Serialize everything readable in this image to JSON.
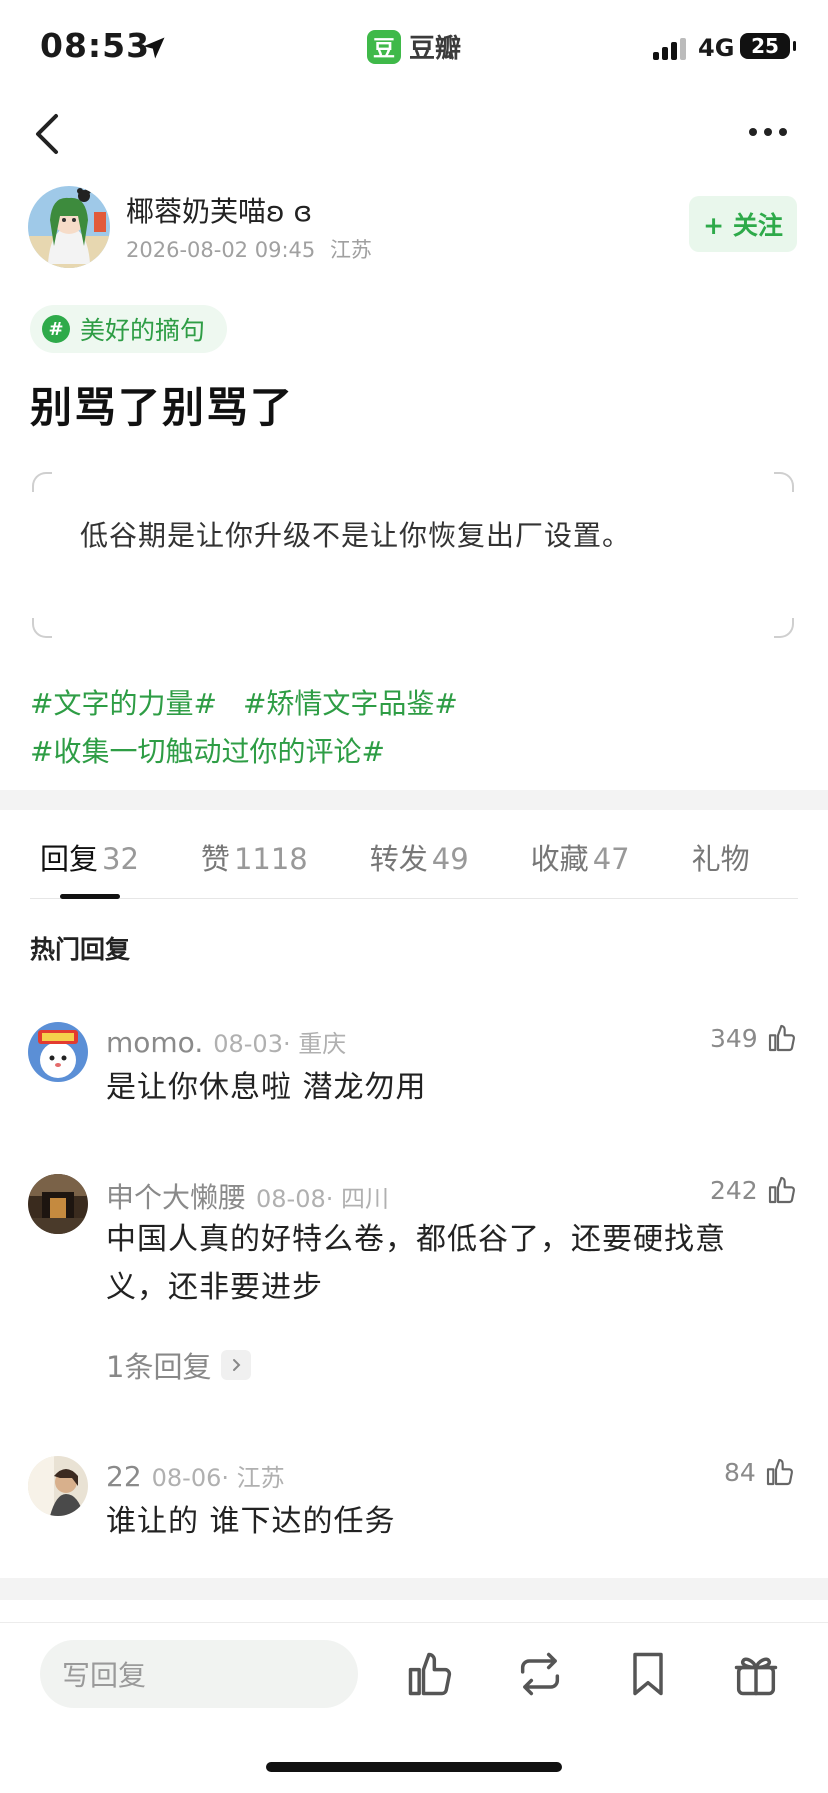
{
  "status_bar": {
    "time": "08:53",
    "app_name": "豆瓣",
    "app_logo_char": "豆",
    "network": "4G",
    "battery": "25"
  },
  "post": {
    "author": "椰蓉奶芙喵ʚ ɞ",
    "date": "2026-08-02 09:45",
    "location": "江苏",
    "follow_label": "+ 关注",
    "topic": "美好的摘句",
    "title": "别骂了别骂了",
    "quote": "低谷期是让你升级不是让你恢复出厂设置。",
    "hashtags": [
      "#文字的力量#",
      "#矫情文字品鉴#",
      "#收集一切触动过你的评论#"
    ]
  },
  "tabs": [
    {
      "label": "回复",
      "count": "32"
    },
    {
      "label": "赞",
      "count": "1118"
    },
    {
      "label": "转发",
      "count": "49"
    },
    {
      "label": "收藏",
      "count": "47"
    },
    {
      "label": "礼物",
      "count": ""
    }
  ],
  "hot_replies_label": "热门回复",
  "comments": [
    {
      "name": "momo.",
      "date": "08-03",
      "location": "重庆",
      "text": "是让你休息啦 潜龙勿用",
      "likes": "349"
    },
    {
      "name": "申个大懒腰",
      "date": "08-08",
      "location": "四川",
      "text": "中国人真的好特么卷，都低谷了，还要硬找意义，还非要进步",
      "likes": "242",
      "replies_label": "1条回复"
    },
    {
      "name": "22",
      "date": "08-06",
      "location": "江苏",
      "text": "谁让的 谁下达的任务",
      "likes": "84"
    }
  ],
  "bottom_bar": {
    "reply_placeholder": "写回复"
  },
  "colors": {
    "accent": "#2eaa4a",
    "accent_bg": "#e9f7ec",
    "text": "#222222",
    "muted": "#a0a0a0"
  }
}
